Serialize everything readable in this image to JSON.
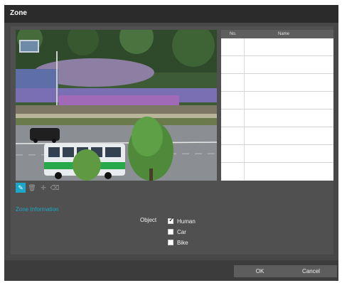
{
  "dialog": {
    "title": "Zone"
  },
  "zone_table": {
    "columns": [
      "No.",
      "Name"
    ],
    "rows": [
      {
        "no": "",
        "name": ""
      },
      {
        "no": "",
        "name": ""
      },
      {
        "no": "",
        "name": ""
      },
      {
        "no": "",
        "name": ""
      },
      {
        "no": "",
        "name": ""
      },
      {
        "no": "",
        "name": ""
      },
      {
        "no": "",
        "name": ""
      },
      {
        "no": "",
        "name": ""
      }
    ]
  },
  "toolbar": {
    "tools": [
      {
        "icon": "draw-zone-icon",
        "active": true
      },
      {
        "icon": "delete-icon",
        "active": false
      },
      {
        "icon": "move-icon",
        "active": false
      },
      {
        "icon": "clear-icon",
        "active": false
      }
    ]
  },
  "zone_information": {
    "title": "Zone Information",
    "object_label": "Object",
    "options": [
      {
        "label": "Human",
        "checked": true
      },
      {
        "label": "Car",
        "checked": false
      },
      {
        "label": "Bike",
        "checked": false
      }
    ]
  },
  "footer": {
    "ok_label": "OK",
    "cancel_label": "Cancel"
  },
  "colors": {
    "accent": "#1aa7c8",
    "dialog_bg": "#474747",
    "title_bar": "#2b2b2b"
  }
}
